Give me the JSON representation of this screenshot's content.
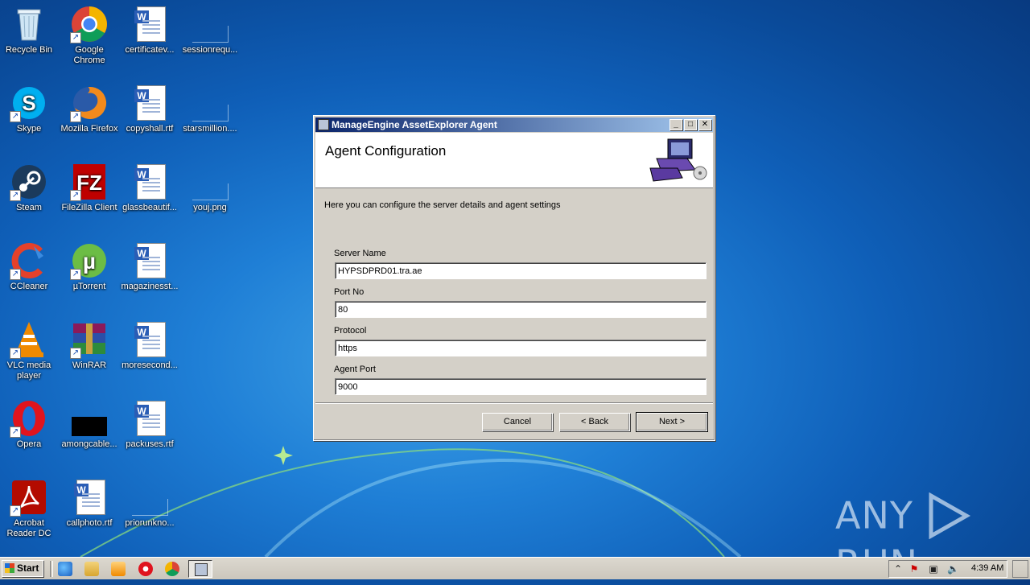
{
  "desktop": {
    "icons": [
      {
        "label": "Recycle Bin",
        "icon": "recycle-bin-icon"
      },
      {
        "label": "Google Chrome",
        "icon": "chrome-icon"
      },
      {
        "label": "certificatev...",
        "icon": "word-document-icon"
      },
      {
        "label": "sessionrequ...",
        "icon": "blank-file-icon"
      },
      {
        "label": "Skype",
        "icon": "skype-icon"
      },
      {
        "label": "Mozilla Firefox",
        "icon": "firefox-icon"
      },
      {
        "label": "copyshall.rtf",
        "icon": "word-document-icon"
      },
      {
        "label": "starsmillion....",
        "icon": "blank-file-icon"
      },
      {
        "label": "Steam",
        "icon": "steam-icon"
      },
      {
        "label": "FileZilla Client",
        "icon": "filezilla-icon"
      },
      {
        "label": "glassbeautif...",
        "icon": "word-document-icon"
      },
      {
        "label": "youj.png",
        "icon": "blank-file-icon"
      },
      {
        "label": "CCleaner",
        "icon": "ccleaner-icon"
      },
      {
        "label": "µTorrent",
        "icon": "utorrent-icon"
      },
      {
        "label": "magazinesst...",
        "icon": "word-document-icon"
      },
      {
        "label": "VLC media player",
        "icon": "vlc-icon"
      },
      {
        "label": "WinRAR",
        "icon": "winrar-icon"
      },
      {
        "label": "moresecond...",
        "icon": "word-document-icon"
      },
      {
        "label": "Opera",
        "icon": "opera-icon"
      },
      {
        "label": "amongcable...",
        "icon": "black-image-icon"
      },
      {
        "label": "packuses.rtf",
        "icon": "word-document-icon"
      },
      {
        "label": "Acrobat Reader DC",
        "icon": "acrobat-icon"
      },
      {
        "label": "callphoto.rtf",
        "icon": "word-document-icon"
      },
      {
        "label": "priorunkno...",
        "icon": "blank-file-icon"
      }
    ]
  },
  "dialog": {
    "title": "ManageEngine AssetExplorer Agent",
    "header_title": "Agent Configuration",
    "description": "Here you can configure the server details and agent settings",
    "fields": [
      {
        "label": "Server Name",
        "value": "HYPSDPRD01.tra.ae"
      },
      {
        "label": "Port No",
        "value": "80"
      },
      {
        "label": "Protocol",
        "value": "https"
      },
      {
        "label": "Agent Port",
        "value": "9000"
      }
    ],
    "buttons": {
      "cancel": "Cancel",
      "back": "< Back",
      "next": "Next >"
    },
    "titlebar_buttons": {
      "minimize": "_",
      "maximize": "□",
      "close": "✕"
    }
  },
  "watermark": {
    "left": "ANY",
    "right": "RUN"
  },
  "taskbar": {
    "start_label": "Start",
    "clock": "4:39 AM",
    "quick_launch": [
      "ie-icon",
      "explorer-icon",
      "media-player-icon",
      "opera-icon",
      "chrome-icon"
    ],
    "active_task_icon": "installer-icon"
  },
  "colors": {
    "desktop": "#1f7fd6",
    "titlebar_start": "#0a246a",
    "titlebar_end": "#a6caf0",
    "dialog_face": "#d4d0c8"
  }
}
